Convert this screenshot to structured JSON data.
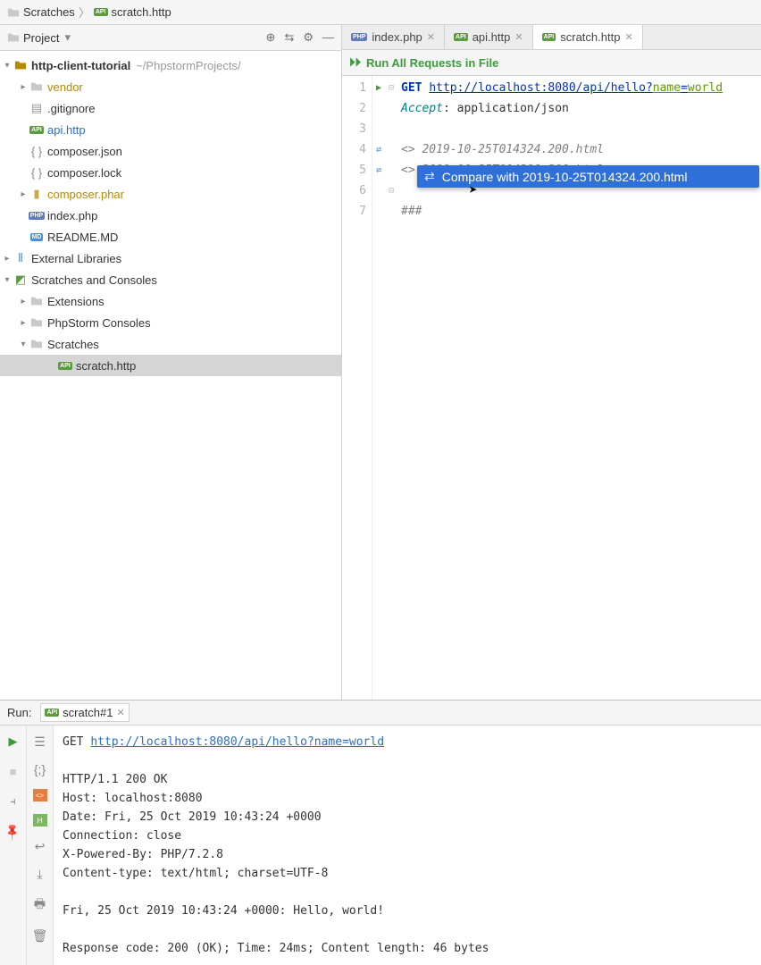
{
  "breadcrumb": {
    "root": "Scratches",
    "file": "scratch.http"
  },
  "sidebar": {
    "title": "Project",
    "tree": {
      "root": {
        "label": "http-client-tutorial",
        "path": "~/PhpstormProjects/"
      },
      "items": [
        {
          "label": "vendor"
        },
        {
          "label": ".gitignore"
        },
        {
          "label": "api.http"
        },
        {
          "label": "composer.json"
        },
        {
          "label": "composer.lock"
        },
        {
          "label": "composer.phar"
        },
        {
          "label": "index.php"
        },
        {
          "label": "README.MD"
        }
      ],
      "ext_libs": "External Libraries",
      "scratches_root": "Scratches and Consoles",
      "scratches_children": [
        {
          "label": "Extensions"
        },
        {
          "label": "PhpStorm Consoles"
        },
        {
          "label": "Scratches"
        }
      ],
      "scratch_file": "scratch.http"
    }
  },
  "tabs": [
    {
      "label": "index.php",
      "kind": "php"
    },
    {
      "label": "api.http",
      "kind": "api"
    },
    {
      "label": "scratch.http",
      "kind": "api",
      "active": true
    }
  ],
  "run_banner": "Run All Requests in File",
  "editor": {
    "method": "GET",
    "url_base": "http://localhost:8080/api/hello?",
    "url_param_key": "name",
    "url_eq": "=",
    "url_param_val": "world",
    "accept_header": "Accept",
    "accept_value": "application/json",
    "resp1": "<> 2019-10-25T014324.200.html",
    "resp2": "<> 2019-10-25T014318.200.html",
    "end": "###"
  },
  "context_menu": "Compare with 2019-10-25T014324.200.html",
  "run": {
    "label": "Run:",
    "tab": "scratch#1",
    "output": {
      "req_method": "GET ",
      "req_url": "http://localhost:8080/api/hello?name=world",
      "lines": [
        "HTTP/1.1 200 OK",
        "Host: localhost:8080",
        "Date: Fri, 25 Oct 2019 10:43:24 +0000",
        "Connection: close",
        "X-Powered-By: PHP/7.2.8",
        "Content-type: text/html; charset=UTF-8"
      ],
      "body": "Fri, 25 Oct 2019 10:43:24 +0000: Hello, world!",
      "summary": "Response code: 200 (OK); Time: 24ms; Content length: 46 bytes"
    }
  }
}
